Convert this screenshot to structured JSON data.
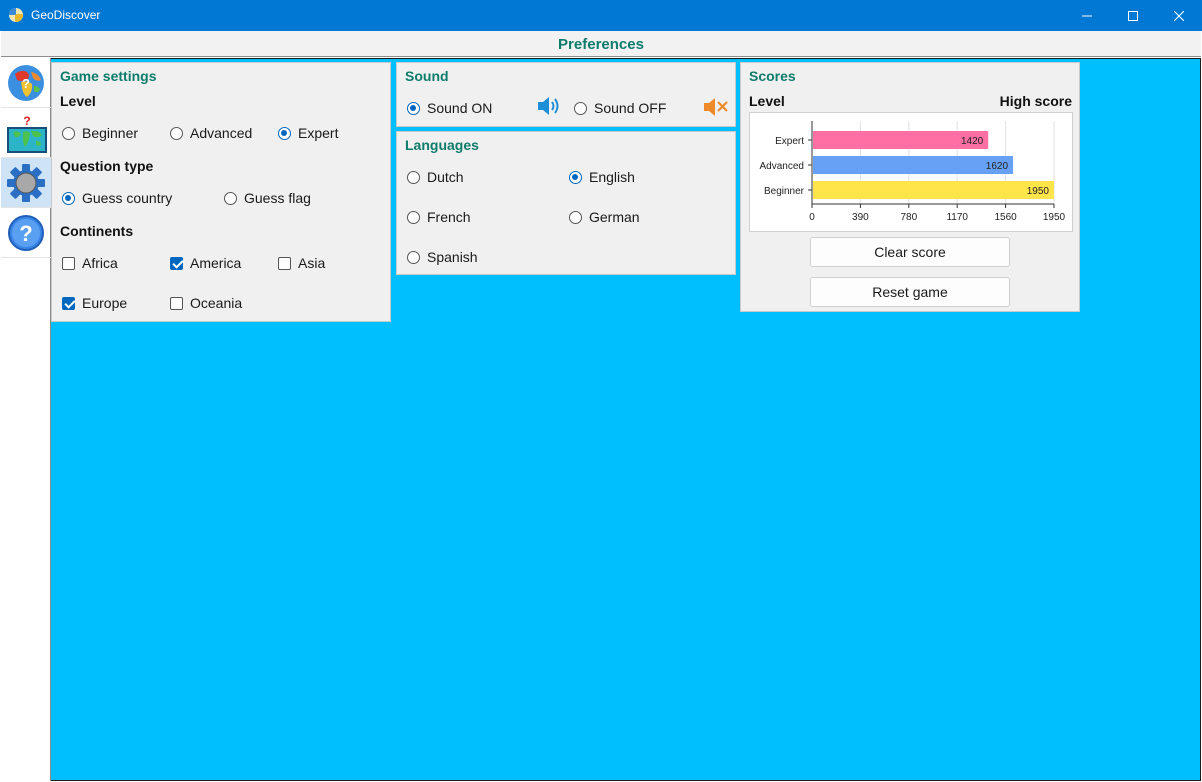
{
  "window": {
    "title": "GeoDiscover"
  },
  "header": {
    "title": "Preferences"
  },
  "sidebar": {
    "items": [
      "globe-icon",
      "map-quiz-icon",
      "settings-gear-icon",
      "help-icon"
    ]
  },
  "game_settings": {
    "title": "Game settings",
    "level": {
      "label": "Level",
      "options": [
        "Beginner",
        "Advanced",
        "Expert"
      ],
      "selected": "Expert"
    },
    "question_type": {
      "label": "Question type",
      "options": [
        "Guess country",
        "Guess flag"
      ],
      "selected": "Guess country"
    },
    "continents": {
      "label": "Continents",
      "items": [
        {
          "label": "Africa",
          "checked": false
        },
        {
          "label": "America",
          "checked": true
        },
        {
          "label": "Asia",
          "checked": false
        },
        {
          "label": "Europe",
          "checked": true
        },
        {
          "label": "Oceania",
          "checked": false
        }
      ]
    }
  },
  "sound": {
    "title": "Sound",
    "on_label": "Sound ON",
    "off_label": "Sound OFF",
    "selected": "on"
  },
  "languages": {
    "title": "Languages",
    "options": [
      "Dutch",
      "English",
      "French",
      "German",
      "Spanish"
    ],
    "selected": "English"
  },
  "scores": {
    "title": "Scores",
    "level_header": "Level",
    "score_header": "High score",
    "clear_button": "Clear score",
    "reset_button": "Reset game"
  },
  "chart_data": {
    "type": "bar",
    "orientation": "horizontal",
    "categories": [
      "Expert",
      "Advanced",
      "Beginner"
    ],
    "values": [
      1420,
      1620,
      1950
    ],
    "xlim": [
      0,
      1950
    ],
    "xticks": [
      0,
      390,
      780,
      1170,
      1560,
      1950
    ],
    "colors": [
      "#ff6fa3",
      "#67a1f6",
      "#ffe44a"
    ],
    "grid": true
  }
}
